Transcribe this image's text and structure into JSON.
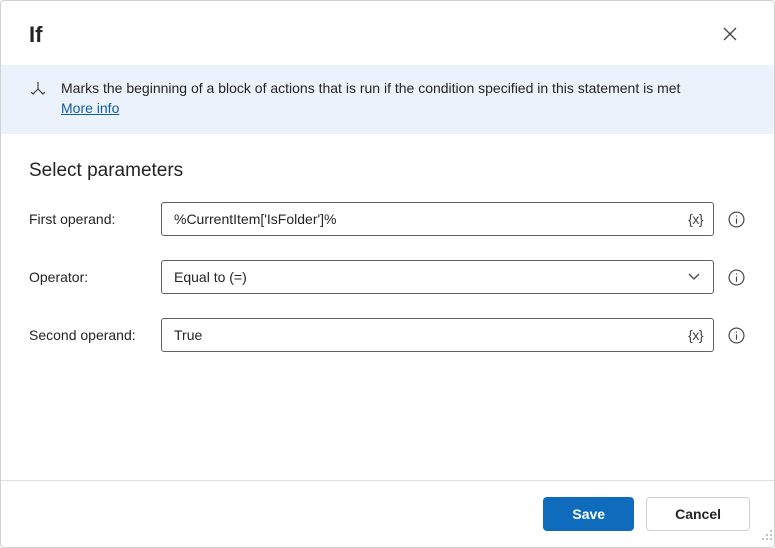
{
  "title": "If",
  "info": {
    "description": "Marks the beginning of a block of actions that is run if the condition specified in this statement is met",
    "more": "More info"
  },
  "section": {
    "heading": "Select parameters"
  },
  "fields": {
    "first": {
      "label": "First operand:",
      "value": "%CurrentItem['IsFolder']%",
      "token": "{x}"
    },
    "operator": {
      "label": "Operator:",
      "value": "Equal to (=)"
    },
    "second": {
      "label": "Second operand:",
      "value": "True",
      "token": "{x}"
    }
  },
  "buttons": {
    "save": "Save",
    "cancel": "Cancel"
  }
}
